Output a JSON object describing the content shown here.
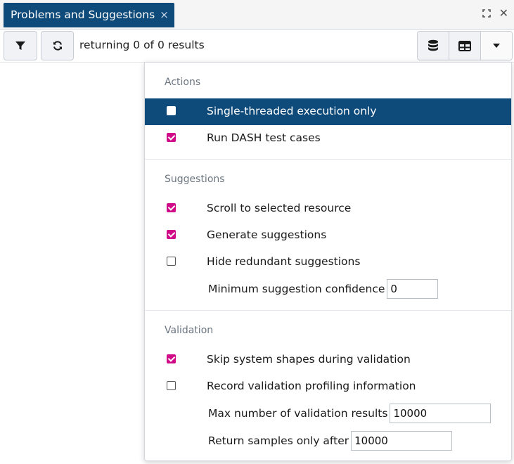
{
  "tab": {
    "title": "Problems and Suggestions",
    "close_glyph": "×"
  },
  "window": {
    "close_glyph": "✕"
  },
  "toolbar": {
    "results_text": "returning 0 of 0 results"
  },
  "menu": {
    "actions_header": "Actions",
    "actions": [
      {
        "label": "Single-threaded execution only",
        "checked": false,
        "highlighted": true
      },
      {
        "label": "Run DASH test cases",
        "checked": true,
        "highlighted": false
      }
    ],
    "suggestions_header": "Suggestions",
    "suggestions": [
      {
        "label": "Scroll to selected resource",
        "checked": true
      },
      {
        "label": "Generate suggestions",
        "checked": true
      },
      {
        "label": "Hide redundant suggestions",
        "checked": false
      }
    ],
    "min_confidence": {
      "label": "Minimum suggestion confidence",
      "value": "0"
    },
    "validation_header": "Validation",
    "validation": [
      {
        "label": "Skip system shapes during validation",
        "checked": true
      },
      {
        "label": "Record validation profiling information",
        "checked": false
      }
    ],
    "max_results": {
      "label": "Max number of validation results",
      "value": "10000"
    },
    "samples_after": {
      "label": "Return samples only after",
      "value": "10000"
    }
  },
  "colors": {
    "accent": "#0e4a7a",
    "checkbox_checked": "#d10a88"
  }
}
